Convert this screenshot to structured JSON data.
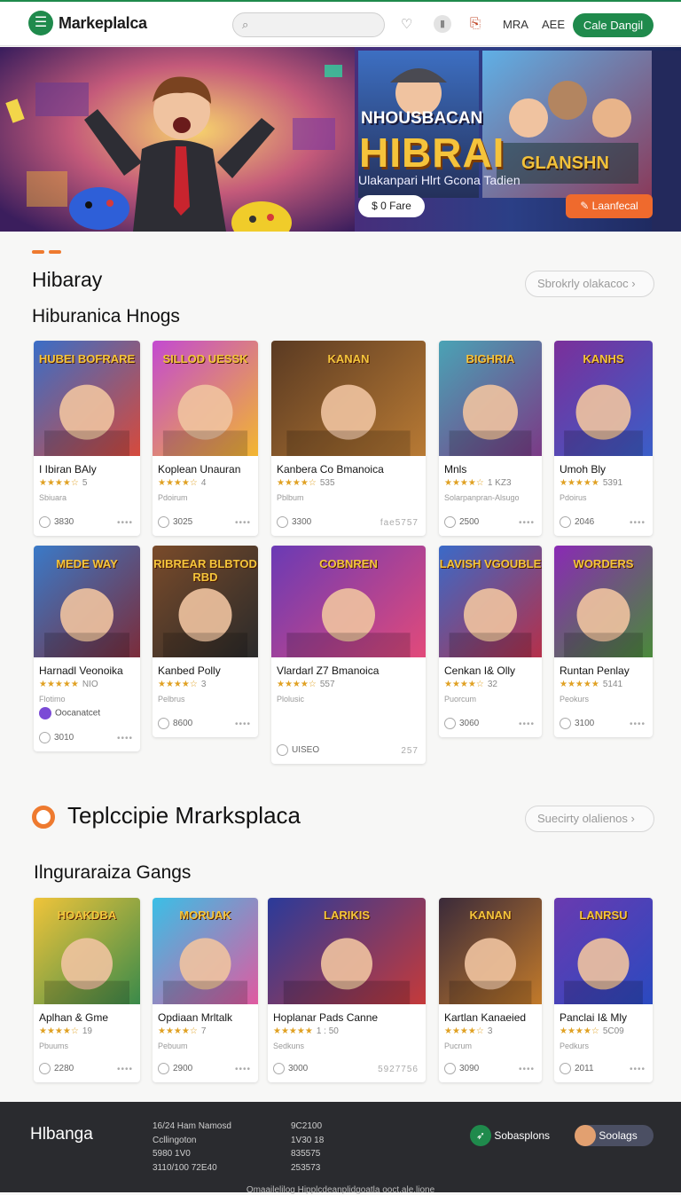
{
  "header": {
    "logo_text": "Markeplalca",
    "search_placeholder": "",
    "nav": [
      "MRA",
      "AEE"
    ],
    "cta_label": "Cale Dangil"
  },
  "hero": {
    "kicker": "NHOUSBACAN",
    "title": "HIBRAI",
    "subtitle": "Ulakanpari Hlrt Gcona Tadien",
    "pill_label": "$ 0 Fare",
    "button_label": "Laanfecal",
    "tile_label": "GLANSHN"
  },
  "section1": {
    "title": "Hibaray",
    "subtitle": "Hiburanica Hnogs",
    "pill_label": "Sbrokrly olakacoc"
  },
  "grid1_row1": [
    {
      "thumb": "HUBEI BOFRARE",
      "name": "I Ibiran BAly",
      "stars": "★★★★☆",
      "num": "5",
      "seller": "Sbiuara",
      "price": "3830",
      "more": "••••"
    },
    {
      "thumb": "SILLOD UESSK",
      "name": "Koplean Unauran",
      "stars": "★★★★☆",
      "num": "4",
      "seller": "Pdoirum",
      "price": "3025",
      "more": "••••"
    },
    {
      "thumb": "KANAN",
      "name": "Kanbera Co Bmanoica",
      "stars": "★★★★☆",
      "num": "535",
      "seller": "Pblbum",
      "price": "3300",
      "more": "fae5757"
    },
    {
      "thumb": "BIGHRIA",
      "name": "Mnls",
      "stars": "★★★★☆",
      "num": "1 KZ3",
      "seller": "Solarpanpran-Alsugo",
      "price": "2500",
      "more": "••••"
    },
    {
      "thumb": "KANHS",
      "name": "Umoh Bly",
      "stars": "★★★★★",
      "num": "5391",
      "seller": "Pdoirus",
      "price": "2046",
      "more": "••••"
    }
  ],
  "grid1_row2": [
    {
      "thumb": "MEDE WAY",
      "name": "Harnadl Veonoika",
      "stars": "★★★★★",
      "num": "NIO",
      "seller": "Flotimo",
      "extra": "Oocanatcet",
      "price": "3010",
      "more": "••••"
    },
    {
      "thumb": "RIBREAR BLBTOD RBD",
      "name": "Kanbed Polly",
      "stars": "★★★★☆",
      "num": "3",
      "seller": "Pelbrus",
      "price": "8600",
      "more": "••••"
    },
    {
      "thumb": "COBNREN",
      "name": "Vlardarl Z7 Bmanoica",
      "stars": "★★★★☆",
      "num": "557",
      "seller": "Plolusic",
      "price": "UISEO",
      "more": "257"
    },
    {
      "thumb": "LAVISH VGOUBLE",
      "name": "Cenkan I& Olly",
      "stars": "★★★★☆",
      "num": "32",
      "seller": "Puorcum",
      "price": "3060",
      "more": "••••"
    },
    {
      "thumb": "WORDERS",
      "name": "Runtan Penlay",
      "stars": "★★★★★",
      "num": "5141",
      "seller": "Peokurs",
      "price": "3100",
      "more": "••••"
    }
  ],
  "section2": {
    "title": "Teplccipie Mrarksplaca",
    "subtitle": "Ilnguraraiza Gangs",
    "pill_label": "Suecirty olalienos"
  },
  "grid2": [
    {
      "thumb": "HOAKDBA",
      "name": "Aplhan & Gme",
      "stars": "★★★★☆",
      "num": "19",
      "seller": "Pbuums",
      "price": "2280",
      "more": "••••"
    },
    {
      "thumb": "MORUAK",
      "name": "Opdiaan Mrltalk",
      "stars": "★★★★☆",
      "num": "7",
      "seller": "Pebuum",
      "price": "2900",
      "more": "••••"
    },
    {
      "thumb": "LARIKIS",
      "name": "Hoplanar Pads Canne",
      "stars": "★★★★★",
      "num": "1 : 50",
      "seller": "Sedkuns",
      "price": "3000",
      "more": "5927756"
    },
    {
      "thumb": "KANAN",
      "name": "Kartlan Kanaeied",
      "stars": "★★★★☆",
      "num": "3",
      "seller": "Pucrum",
      "price": "3090",
      "more": "••••"
    },
    {
      "thumb": "LANRSU",
      "name": "Panclai I& Mly",
      "stars": "★★★★☆",
      "num": "5C09",
      "seller": "Pedkurs",
      "price": "2011",
      "more": "••••"
    }
  ],
  "footer": {
    "brand": "Hlbanga",
    "col1": [
      "16/24 Ham Namosd",
      "Ccllingoton",
      "5980 1V0",
      "3110/100 72E40"
    ],
    "col2": [
      "9C2100",
      "1V30 18",
      "835575",
      "253573"
    ],
    "social1": "Sobasplons",
    "social2": "Soolags",
    "legal": "Omaailelilog Hipplcdeanplidgoatla ooct.ale.lione"
  },
  "colors": {
    "brand": "#1f8a4c",
    "accent": "#ef6a2d",
    "footer": "#2a2b2f"
  }
}
